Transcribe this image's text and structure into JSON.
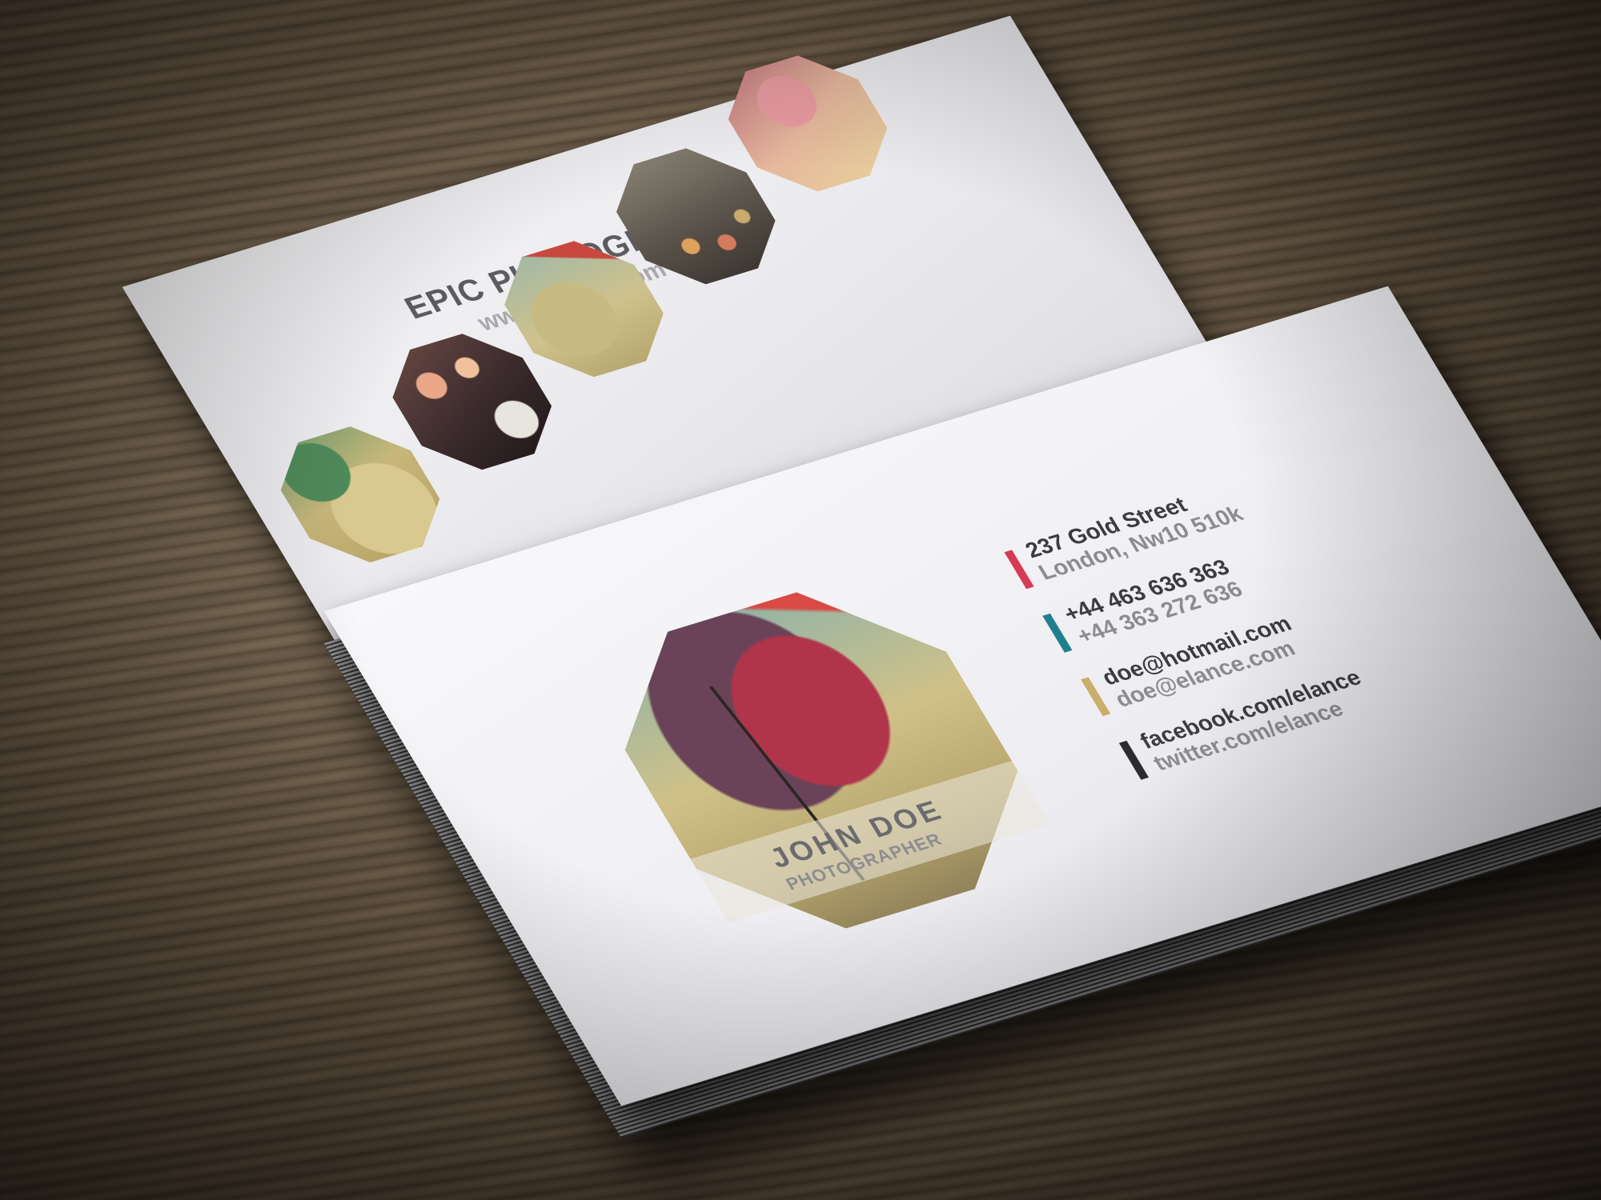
{
  "back_card": {
    "title": "EPIC PHOTOGRAPHY",
    "url": "www.elance.com"
  },
  "front_card": {
    "name": "JOHN  DOE",
    "role": "PHOTOGRAPHER",
    "contacts": [
      {
        "line1": "237 Gold Street",
        "line2": "London, Nw10 510k",
        "color": "#d63a55"
      },
      {
        "line1": "+44 463 636 363",
        "line2": "+44 363 272 636",
        "color": "#1f7f8f"
      },
      {
        "line1": "doe@hotmail.com",
        "line2": "doe@elance.com",
        "color": "#c9b06a"
      },
      {
        "line1": "facebook.com/elance",
        "line2": "twitter.com/elance",
        "color": "#2b2b30"
      }
    ]
  },
  "photos": [
    "butterfly-photo",
    "bokeh-photo",
    "umbrella-photo",
    "lights-photo",
    "rose-photo"
  ]
}
